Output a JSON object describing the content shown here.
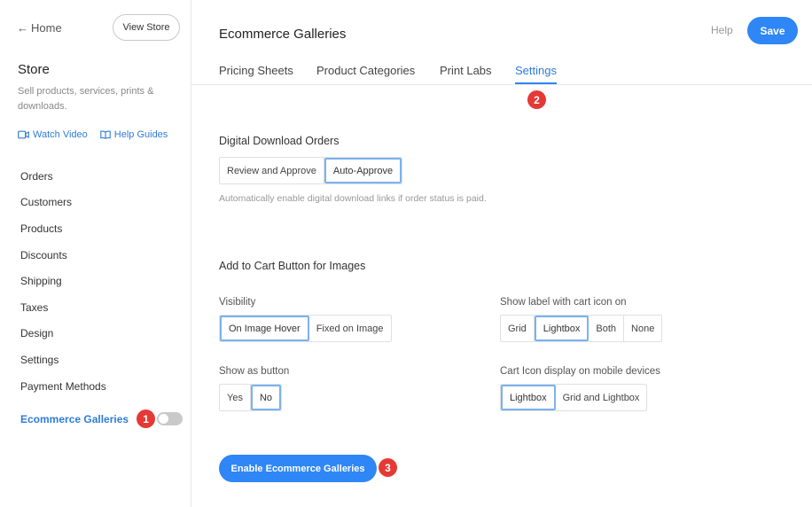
{
  "sidebar": {
    "home_label": "Home",
    "view_store_label": "View Store",
    "title": "Store",
    "description": "Sell products, services, prints & downloads.",
    "watch_video_label": "Watch Video",
    "help_guides_label": "Help Guides",
    "items": [
      {
        "label": "Orders"
      },
      {
        "label": "Customers"
      },
      {
        "label": "Products"
      },
      {
        "label": "Discounts"
      },
      {
        "label": "Shipping"
      },
      {
        "label": "Taxes"
      },
      {
        "label": "Design"
      },
      {
        "label": "Settings"
      },
      {
        "label": "Payment Methods"
      }
    ],
    "ecommerce_galleries_label": "Ecommerce Galleries",
    "ecommerce_galleries_enabled": false,
    "badge_1": "1"
  },
  "header": {
    "title": "Ecommerce Galleries",
    "help_label": "Help",
    "save_label": "Save"
  },
  "tabs": [
    {
      "label": "Pricing Sheets",
      "active": false
    },
    {
      "label": "Product Categories",
      "active": false
    },
    {
      "label": "Print Labs",
      "active": false
    },
    {
      "label": "Settings",
      "active": true
    }
  ],
  "badge_2": "2",
  "digital_download": {
    "title": "Digital Download Orders",
    "options": [
      "Review and Approve",
      "Auto-Approve"
    ],
    "selected": "Auto-Approve",
    "help_text": "Automatically enable digital download links if order status is paid."
  },
  "add_to_cart": {
    "title": "Add to Cart Button for Images",
    "visibility": {
      "label": "Visibility",
      "options": [
        "On Image Hover",
        "Fixed on Image"
      ],
      "selected": "On Image Hover"
    },
    "show_label": {
      "label": "Show label with cart icon on",
      "options": [
        "Grid",
        "Lightbox",
        "Both",
        "None"
      ],
      "selected": "Lightbox"
    },
    "show_as_button": {
      "label": "Show as button",
      "options": [
        "Yes",
        "No"
      ],
      "selected": "No"
    },
    "mobile_display": {
      "label": "Cart Icon display on mobile devices",
      "options": [
        "Lightbox",
        "Grid and Lightbox"
      ],
      "selected": "Lightbox"
    }
  },
  "enable_button_label": "Enable Ecommerce Galleries",
  "badge_3": "3",
  "colors": {
    "accent": "#2f86f6",
    "link": "#2f7bd9",
    "badge": "#e53935",
    "selected_border": "#7ab2f0"
  }
}
